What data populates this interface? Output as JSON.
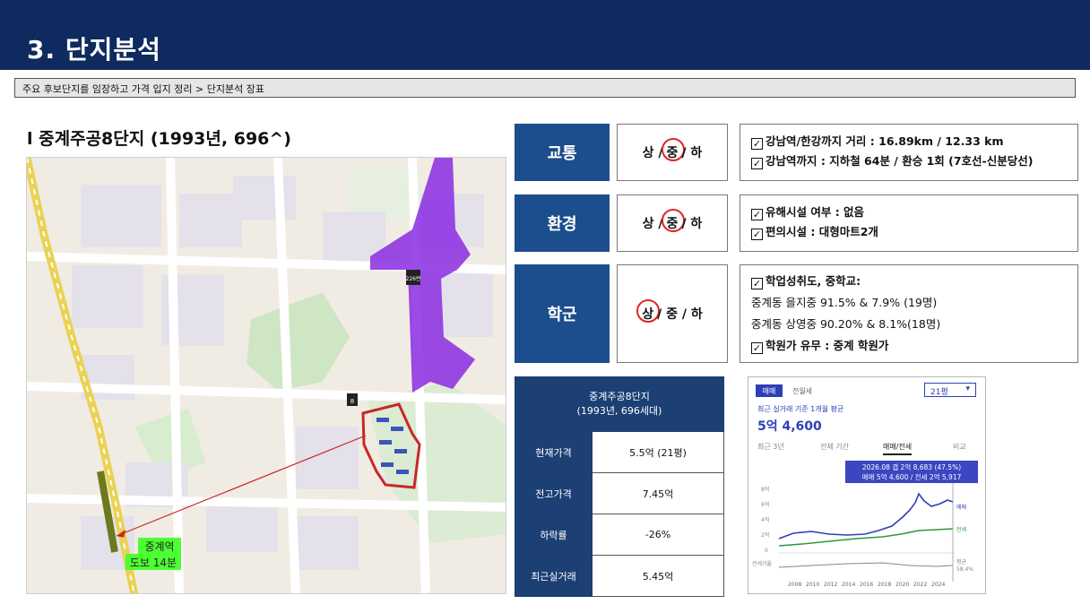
{
  "header": {
    "title": "3. 단지분석"
  },
  "subtitle": "주요 후보단지를 임장하고 가격 입지 정리 > 단지분석 장표",
  "complex_title": "l 중계주공8단지 (1993년, 696^)",
  "map": {
    "station_callout_line1": "중계역",
    "station_callout_line2": "도보 14분",
    "badge_1": "226번",
    "badge_2": "8"
  },
  "metrics": [
    {
      "label": "교통",
      "grade_parts": [
        "상 /",
        "중",
        "/ 하"
      ],
      "selected": "중",
      "details": [
        {
          "text": "강남역/한강까지 거리 : 16.89km / 12.33 km",
          "checked": true
        },
        {
          "text": "강남역까지 : 지하철 64분 / 환승 1회 (7호선-신분당선)",
          "checked": true
        }
      ]
    },
    {
      "label": "환경",
      "grade_parts": [
        "상 /",
        "중",
        "/ 하"
      ],
      "selected": "중",
      "details": [
        {
          "text": "유해시설 여부 : 없음",
          "checked": true
        },
        {
          "text": "편의시설 : 대형마트2개",
          "checked": true
        }
      ]
    },
    {
      "label": "학군",
      "grade_parts": [
        "상",
        "/ 중 / 하"
      ],
      "selected": "상",
      "details": [
        {
          "text": "학업성취도, 중학교:",
          "checked": true
        },
        {
          "text": "중계동 을지중 91.5% & 7.9% (19명)",
          "checked": false
        },
        {
          "text": "중계동 상영중 90.20% & 8.1%(18명)",
          "checked": false
        },
        {
          "text": "학원가 유무 : 중계 학원가",
          "checked": true
        }
      ]
    }
  ],
  "price_table": {
    "header_line1": "중계주공8단지",
    "header_line2": "(1993년, 696세대)",
    "rows": [
      {
        "key": "현재가격",
        "value": "5.5억 (21평)"
      },
      {
        "key": "전고가격",
        "value": "7.45억"
      },
      {
        "key": "하락률",
        "value": "-26%"
      },
      {
        "key": "최근실거래",
        "value": "5.45억"
      }
    ]
  },
  "price_card": {
    "tab_sale": "매매",
    "tab_jeonse": "전월세",
    "size_select": "21평",
    "caption": "최근 실거래 기준 1개월 평균",
    "price": "5억 4,600",
    "periods": [
      "최근 3년",
      "전체 기간",
      "매매/전세",
      "비교"
    ],
    "selected_period": "매매/전세",
    "tooltip_line1": "2026.08 갭 2억 8,683 (47.5%)",
    "tooltip_line2": "매매 5억 4,600 / 전세 2억 5,917",
    "y_ticks": [
      "8억",
      "6억",
      "4억",
      "2억",
      "0"
    ],
    "x_ticks": [
      "2008",
      "2010",
      "2012",
      "2014",
      "2016",
      "2018",
      "2020",
      "2022",
      "2024"
    ],
    "series_labels": [
      "매매",
      "전세"
    ],
    "ratio_label": "전세가율",
    "ratio_value_line1": "평균",
    "ratio_value_line2": "58.4%",
    "colors": {
      "sale": "#2d3fb7",
      "jeonse": "#2e9a3a",
      "ratio": "#888888"
    }
  }
}
